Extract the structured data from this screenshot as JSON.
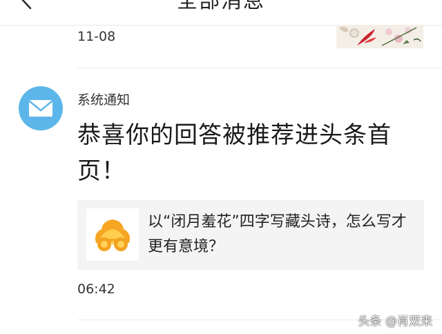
{
  "header": {
    "title": "全部消息",
    "back_icon": "chevron-left-icon"
  },
  "previous_item": {
    "time": "11-08"
  },
  "message": {
    "avatar_icon": "mail-icon",
    "avatar_color": "#5cb6e9",
    "sender": "系统通知",
    "text": "恭喜你的回答被推荐进头条首页！",
    "card": {
      "thumb_icon": "auspicious-cloud-icon",
      "title": "以“闭月羞花”四字写藏头诗，怎么写才更有意境？"
    },
    "time": "06:42"
  },
  "watermark": "头条 @肖双来"
}
